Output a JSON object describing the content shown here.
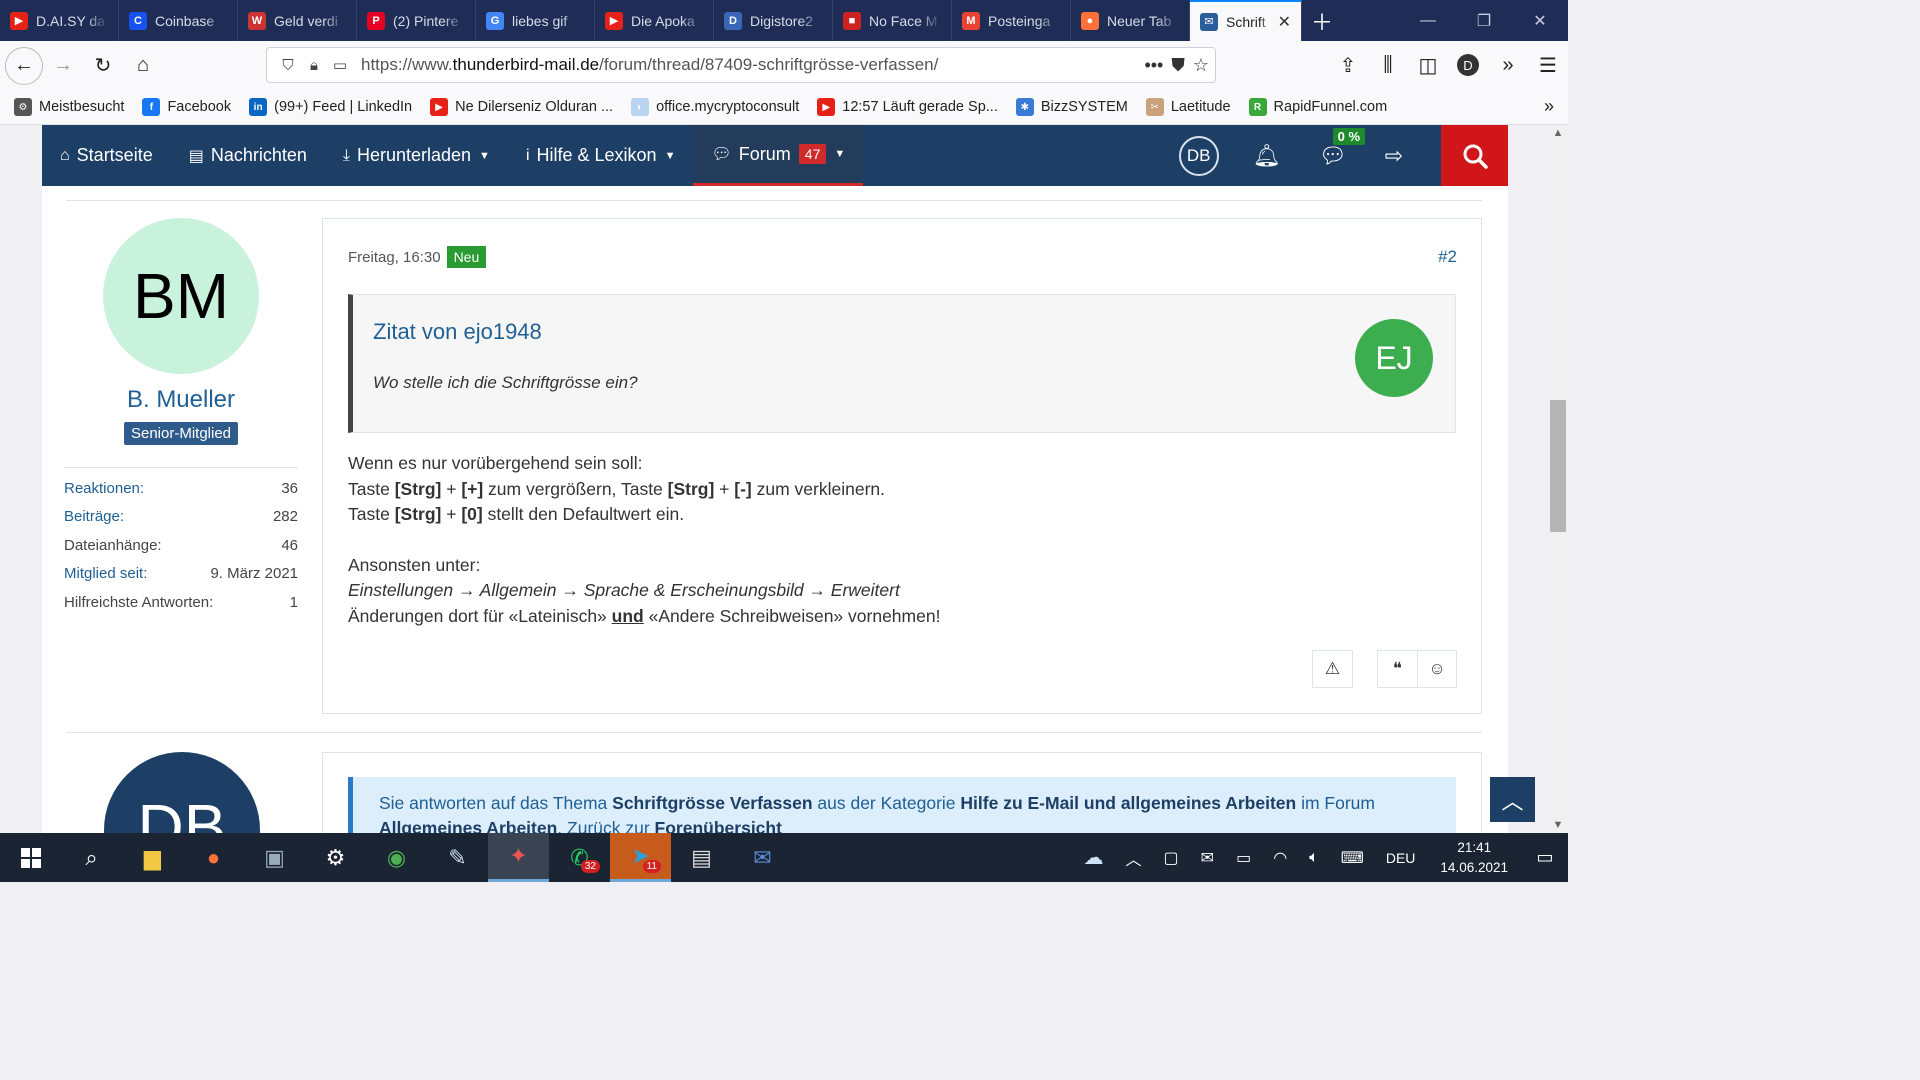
{
  "browser": {
    "tabs": [
      {
        "label": "D.AI.SY da",
        "icon_color": "#e62117",
        "icon": "▶"
      },
      {
        "label": "Coinbase",
        "icon_color": "#1652f0",
        "icon": "C"
      },
      {
        "label": "Geld verdi",
        "icon_color": "#c33",
        "icon": "W"
      },
      {
        "label": "(2) Pintere",
        "icon_color": "#e60023",
        "icon": "P"
      },
      {
        "label": "liebes gif",
        "icon_color": "#4285f4",
        "icon": "G"
      },
      {
        "label": "Die Apoka",
        "icon_color": "#e62117",
        "icon": "▶"
      },
      {
        "label": "Digistore2",
        "icon_color": "#3a66b8",
        "icon": "D"
      },
      {
        "label": "No Face M",
        "icon_color": "#c22",
        "icon": "■"
      },
      {
        "label": "Posteinga",
        "icon_color": "#ea4335",
        "icon": "M"
      },
      {
        "label": "Neuer Tab",
        "icon_color": "#ff7139",
        "icon": "●"
      }
    ],
    "active_tab": {
      "label": "Schrift",
      "icon_color": "#2a5d9b",
      "icon": "✉"
    },
    "url_prefix": "https://www.",
    "url_domain": "thunderbird-mail.de",
    "url_path": "/forum/thread/87409-schriftgrösse-verfassen/",
    "bookmarks": [
      {
        "label": "Meistbesucht",
        "icon_color": "#555",
        "icon": "⚙"
      },
      {
        "label": "Facebook",
        "icon_color": "#1877f2",
        "icon": "f"
      },
      {
        "label": "(99+) Feed | LinkedIn",
        "icon_color": "#0a66c2",
        "icon": "in"
      },
      {
        "label": "Ne Dilerseniz Olduran ...",
        "icon_color": "#e62117",
        "icon": "▶"
      },
      {
        "label": "office.mycryptoconsult",
        "icon_color": "#b9d4ee",
        "icon": "◐"
      },
      {
        "label": "12:57 Läuft gerade Sp...",
        "icon_color": "#e62117",
        "icon": "▶"
      },
      {
        "label": "BizzSYSTEM",
        "icon_color": "#3a7bd5",
        "icon": "✱"
      },
      {
        "label": "Laetitude",
        "icon_color": "#c9a27c",
        "icon": "✂"
      },
      {
        "label": "RapidFunnel.com",
        "icon_color": "#3aa83a",
        "icon": "R"
      }
    ],
    "profile_initial": "D"
  },
  "site_nav": {
    "items": [
      {
        "label": "Startseite",
        "icon": "⌂"
      },
      {
        "label": "Nachrichten",
        "icon": "▤"
      },
      {
        "label": "Herunterladen",
        "icon": "⤓"
      },
      {
        "label": "Hilfe & Lexikon",
        "icon": "i"
      }
    ],
    "forum_label": "Forum",
    "forum_badge": "47",
    "user_initials": "DB",
    "progress": "0 %"
  },
  "author": {
    "initials": "BM",
    "name": "B. Mueller",
    "rank": "Senior-Mitglied",
    "stats": [
      {
        "key": "Reaktionen:",
        "value": "36"
      },
      {
        "key": "Beiträge:",
        "value": "282"
      },
      {
        "key": "Dateianhänge:",
        "value": "46"
      },
      {
        "key": "Mitglied seit:",
        "value": "9. März 2021"
      },
      {
        "key": "Hilfreichste Antworten:",
        "value": "1"
      }
    ]
  },
  "post": {
    "time": "Freitag, 16:30",
    "new_badge": "Neu",
    "number": "#2",
    "quote_author": "Zitat von ejo1948",
    "quote_text": "Wo stelle ich die Schriftgrösse ein?",
    "quote_initials": "EJ",
    "line1": "Wenn es nur vorübergehend sein soll:",
    "line2_a": "Taste ",
    "key_strg": "[Strg]",
    "key_plus": "[+]",
    "key_minus": "[-]",
    "key_zero": "[0]",
    "line2_b": " zum vergrößern, Taste ",
    "line2_c": " zum verkleinern.",
    "line3_b": " stellt den Defaultwert ein.",
    "plus_sign": " + ",
    "line4": "Ansonsten unter:",
    "path": "Einstellungen → Allgemein → Sprache & Erscheinungsbild → Erweitert",
    "line6_a": "Änderungen dort für «Lateinisch» ",
    "line6_und": "und",
    "line6_b": " «Andere Schreibweisen» vornehmen!"
  },
  "reply": {
    "avatar_initials": "DB",
    "notice_a": "Sie antworten auf das Thema ",
    "topic": "Schriftgrösse Verfassen",
    "notice_b": " aus der Kategorie ",
    "category": "Hilfe zu E-Mail und allgemeines Arbeiten",
    "notice_c": " im Forum",
    "forum": "Allgemeines Arbeiten",
    "notice_d": ". Zurück zur ",
    "overview": "Forenübersicht"
  },
  "taskbar": {
    "whatsapp_count": "32",
    "telegram_count": "11",
    "lang": "DEU",
    "time": "21:41",
    "date": "14.06.2021"
  }
}
